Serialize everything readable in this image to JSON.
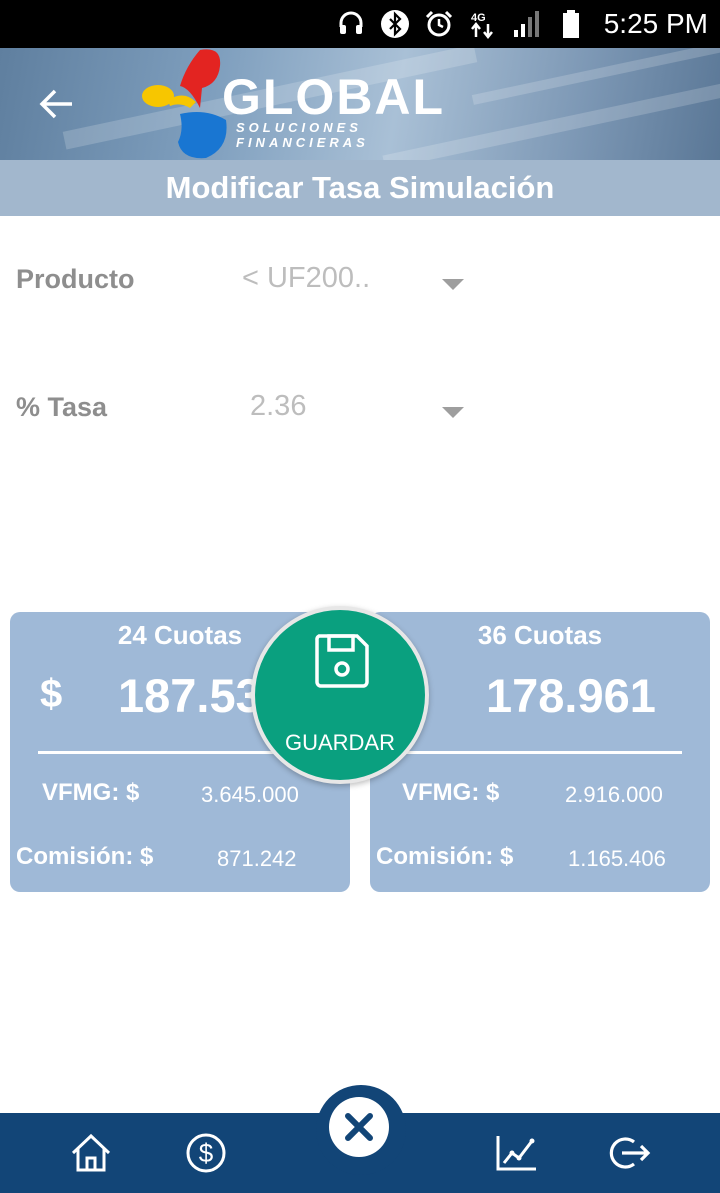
{
  "status_bar": {
    "time": "5:25 PM",
    "icons": [
      "headset-icon",
      "bluetooth-icon",
      "alarm-icon",
      "4g-data-icon",
      "signal-icon",
      "battery-icon"
    ]
  },
  "header": {
    "logo_word": "GLOBAL",
    "logo_sub": "SOLUCIONES FINANCIERAS"
  },
  "page_title": "Modificar Tasa Simulación",
  "form": {
    "producto_label": "Producto",
    "producto_value": "< UF200..",
    "tasa_label": "% Tasa",
    "tasa_value": "2.36"
  },
  "cards": [
    {
      "cuotas": "24 Cuotas",
      "currency": "$",
      "amount": "187.53",
      "vfmg_label": "VFMG: $",
      "vfmg_value": "3.645.000",
      "comision_label": "Comisión: $",
      "comision_value": "871.242"
    },
    {
      "cuotas": "36 Cuotas",
      "amount": "178.961",
      "vfmg_label": "VFMG: $",
      "vfmg_value": "2.916.000",
      "comision_label": "Comisión: $",
      "comision_value": "1.165.406"
    }
  ],
  "guardar_label": "GUARDAR",
  "colors": {
    "header_bar": "#a2b7cd",
    "card": "#9fb9d7",
    "guardar": "#0aa07f",
    "navbar": "#124577"
  },
  "navbar": {
    "items": [
      "home-icon",
      "dollar-icon",
      "close-icon",
      "chart-icon",
      "logout-icon"
    ]
  }
}
